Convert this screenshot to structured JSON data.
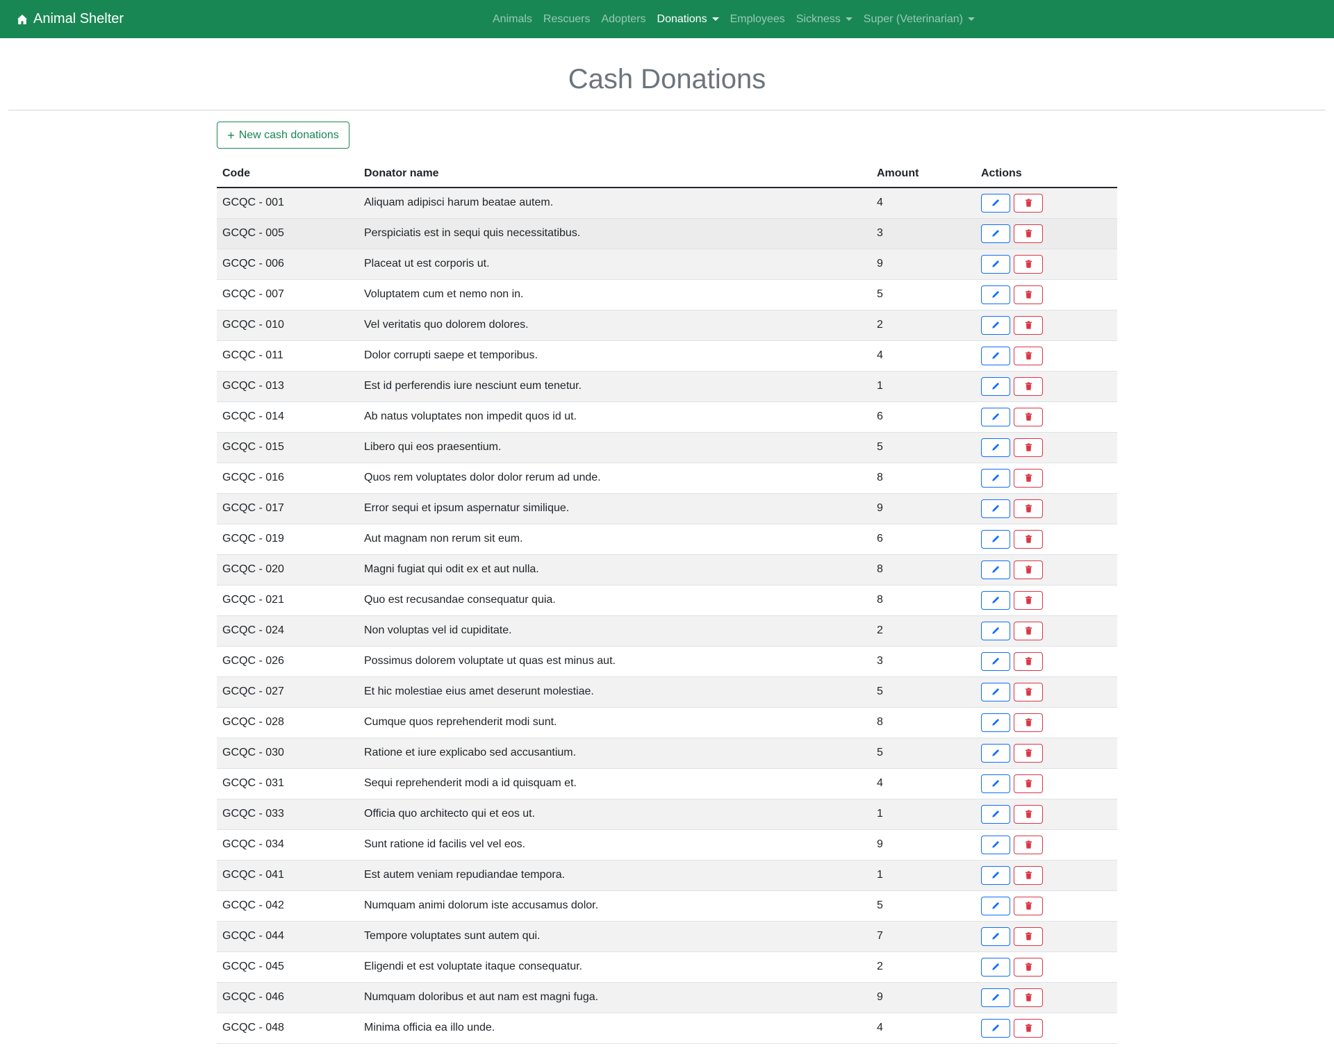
{
  "nav": {
    "brand": "Animal Shelter",
    "links": [
      {
        "label": "Animals",
        "dropdown": false,
        "active": false
      },
      {
        "label": "Rescuers",
        "dropdown": false,
        "active": false
      },
      {
        "label": "Adopters",
        "dropdown": false,
        "active": false
      },
      {
        "label": "Donations",
        "dropdown": true,
        "active": true
      },
      {
        "label": "Employees",
        "dropdown": false,
        "active": false
      },
      {
        "label": "Sickness",
        "dropdown": true,
        "active": false
      },
      {
        "label": "Super (Veterinarian)",
        "dropdown": true,
        "active": false
      }
    ]
  },
  "page": {
    "title": "Cash Donations",
    "new_button": "New cash donations"
  },
  "table": {
    "headers": {
      "code": "Code",
      "donator": "Donator name",
      "amount": "Amount",
      "actions": "Actions"
    },
    "rows": [
      {
        "code": "GCQC - 001",
        "donator": "Aliquam adipisci harum beatae autem.",
        "amount": "4"
      },
      {
        "code": "GCQC - 005",
        "donator": "Perspiciatis est in sequi quis necessitatibus.",
        "amount": "3"
      },
      {
        "code": "GCQC - 006",
        "donator": "Placeat ut est corporis ut.",
        "amount": "9"
      },
      {
        "code": "GCQC - 007",
        "donator": "Voluptatem cum et nemo non in.",
        "amount": "5"
      },
      {
        "code": "GCQC - 010",
        "donator": "Vel veritatis quo dolorem dolores.",
        "amount": "2"
      },
      {
        "code": "GCQC - 011",
        "donator": "Dolor corrupti saepe et temporibus.",
        "amount": "4"
      },
      {
        "code": "GCQC - 013",
        "donator": "Est id perferendis iure nesciunt eum tenetur.",
        "amount": "1"
      },
      {
        "code": "GCQC - 014",
        "donator": "Ab natus voluptates non impedit quos id ut.",
        "amount": "6"
      },
      {
        "code": "GCQC - 015",
        "donator": "Libero qui eos praesentium.",
        "amount": "5"
      },
      {
        "code": "GCQC - 016",
        "donator": "Quos rem voluptates dolor dolor rerum ad unde.",
        "amount": "8"
      },
      {
        "code": "GCQC - 017",
        "donator": "Error sequi et ipsum aspernatur similique.",
        "amount": "9"
      },
      {
        "code": "GCQC - 019",
        "donator": "Aut magnam non rerum sit eum.",
        "amount": "6"
      },
      {
        "code": "GCQC - 020",
        "donator": "Magni fugiat qui odit ex et aut nulla.",
        "amount": "8"
      },
      {
        "code": "GCQC - 021",
        "donator": "Quo est recusandae consequatur quia.",
        "amount": "8"
      },
      {
        "code": "GCQC - 024",
        "donator": "Non voluptas vel id cupiditate.",
        "amount": "2"
      },
      {
        "code": "GCQC - 026",
        "donator": "Possimus dolorem voluptate ut quas est minus aut.",
        "amount": "3"
      },
      {
        "code": "GCQC - 027",
        "donator": "Et hic molestiae eius amet deserunt molestiae.",
        "amount": "5"
      },
      {
        "code": "GCQC - 028",
        "donator": "Cumque quos reprehenderit modi sunt.",
        "amount": "8"
      },
      {
        "code": "GCQC - 030",
        "donator": "Ratione et iure explicabo sed accusantium.",
        "amount": "5"
      },
      {
        "code": "GCQC - 031",
        "donator": "Sequi reprehenderit modi a id quisquam et.",
        "amount": "4"
      },
      {
        "code": "GCQC - 033",
        "donator": "Officia quo architecto qui et eos ut.",
        "amount": "1"
      },
      {
        "code": "GCQC - 034",
        "donator": "Sunt ratione id facilis vel vel eos.",
        "amount": "9"
      },
      {
        "code": "GCQC - 041",
        "donator": "Est autem veniam repudiandae tempora.",
        "amount": "1"
      },
      {
        "code": "GCQC - 042",
        "donator": "Numquam animi dolorum iste accusamus dolor.",
        "amount": "5"
      },
      {
        "code": "GCQC - 044",
        "donator": "Tempore voluptates sunt autem qui.",
        "amount": "7"
      },
      {
        "code": "GCQC - 045",
        "donator": "Eligendi et est voluptate itaque consequatur.",
        "amount": "2"
      },
      {
        "code": "GCQC - 046",
        "donator": "Numquam doloribus et aut nam est magni fuga.",
        "amount": "9"
      },
      {
        "code": "GCQC - 048",
        "donator": "Minima officia ea illo unde.",
        "amount": "4"
      }
    ]
  },
  "icons": {
    "brand": "house-icon",
    "new": "plus-icon",
    "edit": "pencil-icon",
    "delete": "trash-icon"
  },
  "colors": {
    "navbar": "#198754",
    "primary": "#0d6efd",
    "danger": "#dc3545",
    "success": "#198754"
  }
}
